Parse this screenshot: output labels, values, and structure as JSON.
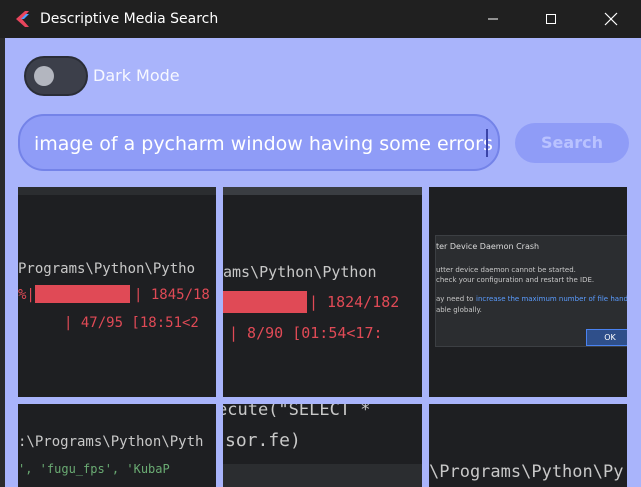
{
  "window": {
    "title": "Descriptive Media Search",
    "controls": [
      "minimize",
      "maximize",
      "close"
    ]
  },
  "dark_mode": {
    "label": "Dark Mode",
    "enabled": false
  },
  "search": {
    "query": "image of a pycharm window having some errors",
    "button_label": "Search"
  },
  "results": {
    "tile1": {
      "lines": [
        "Programs\\Python\\Pytho",
        "%|",
        "| 1845/18",
        "| 47/95 [18:51<2"
      ]
    },
    "tile2": {
      "lines": [
        "ams\\Python\\Python",
        "| 1824/182",
        "| 8/90 [01:54<17:"
      ]
    },
    "tile3": {
      "dialog_title": "ter Device Daemon Crash",
      "dialog_lines": [
        "utter device daemon cannot be started.",
        "check your configuration and restart the IDE.",
        "ay need to",
        "increase the maximum number of file handles",
        "able globally."
      ],
      "ok_label": "OK"
    },
    "tile4": {
      "lines": [
        ":\\Programs\\Python\\Pyth",
        "', 'fugu_fps', 'KubaP"
      ]
    },
    "tile5": {
      "lines": [
        "ecute(\"SELECT * ",
        "sor.fe)"
      ]
    },
    "tile6": {
      "lines": [
        "\\Programs\\Python\\Py"
      ]
    }
  },
  "colors": {
    "background": "#a9b4fb",
    "accent": "#8f9cf7",
    "titlebar": "#202020",
    "error_red": "#e04a56"
  }
}
